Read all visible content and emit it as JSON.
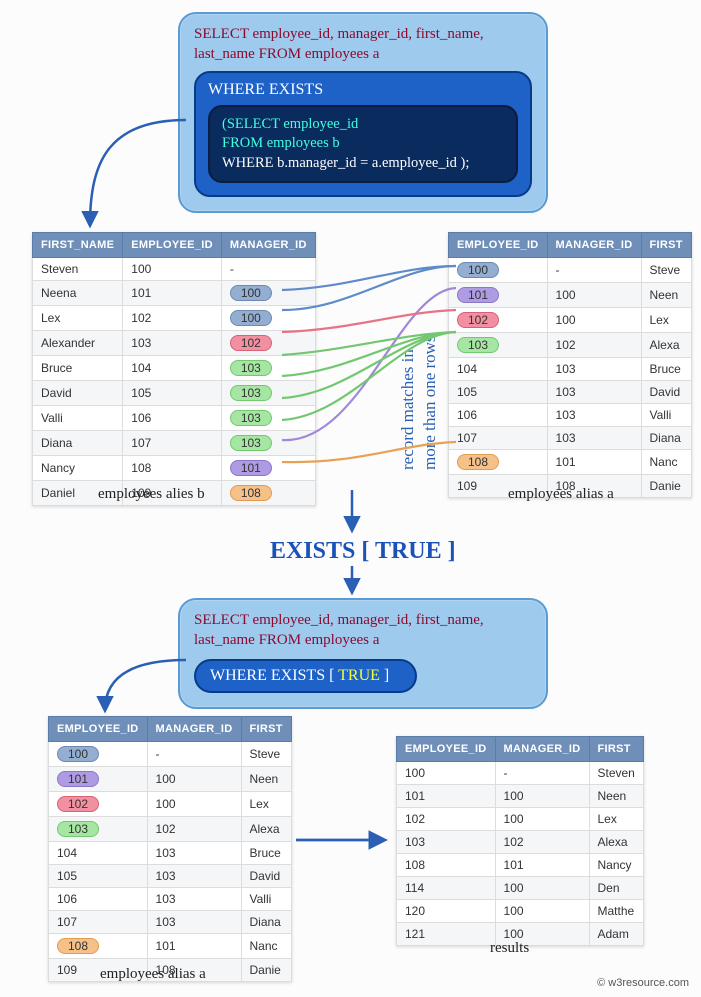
{
  "sql_box_top": {
    "outer_text": "SELECT employee_id, manager_id, first_name, last_name FROM employees a",
    "where_label": "WHERE EXISTS",
    "inner_line1_open": "(",
    "inner_line1": "SELECT employee_id",
    "inner_line2": "FROM employees b",
    "inner_line3": "WHERE b.manager_id = a.employee_id );"
  },
  "sql_box_bottom": {
    "outer_text": "SELECT employee_id, manager_id, first_name, last_name FROM employees a",
    "where_label": "WHERE EXISTS [ ",
    "true": "TRUE",
    "close": " ]"
  },
  "headers": {
    "first_name": "FIRST_NAME",
    "employee_id": "EMPLOYEE_ID",
    "manager_id": "MANAGER_ID",
    "first_cut": "FIRST"
  },
  "table_b": {
    "caption": "employees alies b",
    "rows": [
      {
        "first": "Steven",
        "emp": "100",
        "mgr": "-",
        "mgr_pill": ""
      },
      {
        "first": "Neena",
        "emp": "101",
        "mgr": "100",
        "mgr_pill": "p-blue"
      },
      {
        "first": "Lex",
        "emp": "102",
        "mgr": "100",
        "mgr_pill": "p-blue"
      },
      {
        "first": "Alexander",
        "emp": "103",
        "mgr": "102",
        "mgr_pill": "p-red"
      },
      {
        "first": "Bruce",
        "emp": "104",
        "mgr": "103",
        "mgr_pill": "p-green"
      },
      {
        "first": "David",
        "emp": "105",
        "mgr": "103",
        "mgr_pill": "p-green"
      },
      {
        "first": "Valli",
        "emp": "106",
        "mgr": "103",
        "mgr_pill": "p-green"
      },
      {
        "first": "Diana",
        "emp": "107",
        "mgr": "103",
        "mgr_pill": "p-green"
      },
      {
        "first": "Nancy",
        "emp": "108",
        "mgr": "101",
        "mgr_pill": "p-purple"
      },
      {
        "first": "Daniel",
        "emp": "109",
        "mgr": "108",
        "mgr_pill": "p-orange"
      }
    ]
  },
  "table_a_top": {
    "caption": "employees alias a",
    "rows": [
      {
        "emp": "100",
        "mgr": "-",
        "first": "Steve",
        "emp_pill": "p-blue"
      },
      {
        "emp": "101",
        "mgr": "100",
        "first": "Neen",
        "emp_pill": "p-purple"
      },
      {
        "emp": "102",
        "mgr": "100",
        "first": "Lex",
        "emp_pill": "p-red"
      },
      {
        "emp": "103",
        "mgr": "102",
        "first": "Alexa",
        "emp_pill": "p-green"
      },
      {
        "emp": "104",
        "mgr": "103",
        "first": "Bruce",
        "emp_pill": ""
      },
      {
        "emp": "105",
        "mgr": "103",
        "first": "David",
        "emp_pill": ""
      },
      {
        "emp": "106",
        "mgr": "103",
        "first": "Valli",
        "emp_pill": ""
      },
      {
        "emp": "107",
        "mgr": "103",
        "first": "Diana",
        "emp_pill": ""
      },
      {
        "emp": "108",
        "mgr": "101",
        "first": "Nanc",
        "emp_pill": "p-orange"
      },
      {
        "emp": "109",
        "mgr": "108",
        "first": "Danie",
        "emp_pill": ""
      }
    ]
  },
  "table_a_bottom": {
    "caption": "employees alias a",
    "rows": [
      {
        "emp": "100",
        "mgr": "-",
        "first": "Steve",
        "emp_pill": "p-blue"
      },
      {
        "emp": "101",
        "mgr": "100",
        "first": "Neen",
        "emp_pill": "p-purple"
      },
      {
        "emp": "102",
        "mgr": "100",
        "first": "Lex",
        "emp_pill": "p-red"
      },
      {
        "emp": "103",
        "mgr": "102",
        "first": "Alexa",
        "emp_pill": "p-green"
      },
      {
        "emp": "104",
        "mgr": "103",
        "first": "Bruce",
        "emp_pill": ""
      },
      {
        "emp": "105",
        "mgr": "103",
        "first": "David",
        "emp_pill": ""
      },
      {
        "emp": "106",
        "mgr": "103",
        "first": "Valli",
        "emp_pill": ""
      },
      {
        "emp": "107",
        "mgr": "103",
        "first": "Diana",
        "emp_pill": ""
      },
      {
        "emp": "108",
        "mgr": "101",
        "first": "Nanc",
        "emp_pill": "p-orange"
      },
      {
        "emp": "109",
        "mgr": "108",
        "first": "Danie",
        "emp_pill": ""
      }
    ]
  },
  "results": {
    "caption": "results",
    "rows": [
      {
        "emp": "100",
        "mgr": "-",
        "first": "Steven"
      },
      {
        "emp": "101",
        "mgr": "100",
        "first": "Neen"
      },
      {
        "emp": "102",
        "mgr": "100",
        "first": "Lex"
      },
      {
        "emp": "103",
        "mgr": "102",
        "first": "Alexa"
      },
      {
        "emp": "108",
        "mgr": "101",
        "first": "Nancy"
      },
      {
        "emp": "114",
        "mgr": "100",
        "first": "Den"
      },
      {
        "emp": "120",
        "mgr": "100",
        "first": "Matthe"
      },
      {
        "emp": "121",
        "mgr": "100",
        "first": "Adam"
      }
    ]
  },
  "side_text": {
    "line1": "record matches in",
    "line2": "more than  one rows"
  },
  "exists_true": "EXISTS [ TRUE ]",
  "copyright": "© w3resource.com",
  "colors": {
    "blue": "#94aed2",
    "purple": "#ae9be3",
    "red": "#f28fa0",
    "green": "#a6e6a3",
    "orange": "#f6c089",
    "link_blue": "#5e8bc9",
    "link_purple": "#9f88d9",
    "link_red": "#e77386",
    "link_green": "#74c771",
    "link_orange": "#e7a255"
  }
}
